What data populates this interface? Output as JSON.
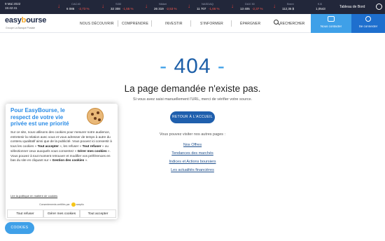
{
  "ticker": {
    "date": "9 Mai 2022",
    "time": "15:42:41",
    "items": [
      {
        "name": "CAC40",
        "value": "6 086",
        "change": "-2,73 %"
      },
      {
        "name": "SI30",
        "value": "32 308",
        "change": "-1,55 %"
      },
      {
        "name": "Nikkei",
        "value": "26 319",
        "change": "-2,53 %"
      },
      {
        "name": "NASDAQ",
        "value": "11 707",
        "change": "-1,66 %"
      },
      {
        "name": "DAX 30",
        "value": "13 405",
        "change": "-2,37 %"
      },
      {
        "name": "Brent",
        "value": "112,35 $",
        "change": ""
      },
      {
        "name": "€-$",
        "value": "1,0543",
        "change": ""
      }
    ],
    "dashboard_label": "Tableau de Bord"
  },
  "header": {
    "logo_main": "easy",
    "logo_y": "b",
    "logo_rest": "ourse",
    "logo_sub": "Groupe La Banque Postale",
    "nav": [
      "NOUS DÉCOUVRIR",
      "COMPRENDRE",
      "INVESTIR",
      "S'INFORMER",
      "ÉPARGNER"
    ],
    "search_label": "RECHERCHER",
    "contact_label": "Nous contacter",
    "login_label": "Se connecter"
  },
  "main": {
    "code_dash_left": "- ",
    "code": "404",
    "code_dash_right": " -",
    "title": "La page demandée n'existe pas.",
    "subtitle": "Si vous avez saisi manuellement l'URL, merci de vérifier votre source.",
    "back_button": "RETOUR À L'ACCUEIL",
    "other_pages": "Vous pouvez visiter nos autres pages :",
    "links": [
      "Nos Offres",
      "Tendances des marchés",
      "Indices et Actions boursiers",
      "Les actualités financières"
    ]
  },
  "cookie": {
    "title": "Pour EasyBourse, le respect de votre vie privée est une priorité",
    "body_p1": "Sur ce site, nous utilisons des cookies pour mesurer notre audience, entretenir la relation avec vous et vous adresser de temps à autre du contenu qualitatif ainsi que de la publicité. Vous pouvez ici consentir à tous les cookies « ",
    "b1": "Tout accepter",
    "body_p2": " », les refuser « ",
    "b2": "Tout refuser",
    "body_p3": " » ou sélectionner ceux auxquels vous consentez « ",
    "b3": "Gérer mes cookies",
    "body_p4": " ». Vous pouvez à tout moment retrouver et modifier vos préférences en bas du site en cliquant sur « ",
    "b4": "Gestion des cookies",
    "body_p5": " ».",
    "policy_link": "Lire la politique en matière de cookies",
    "certified_prefix": "Consentements certifiés par",
    "certified_brand": "axeptio",
    "btn_refuse": "Tout refuser",
    "btn_manage": "Gérer mes cookies",
    "btn_accept": "Tout accepter",
    "fab": "COOKIES"
  },
  "colors": {
    "ticker_bg": "#22273a",
    "negative": "#ff5b4f",
    "brand_blue": "#1d5fa8",
    "accent_blue": "#3fa0e8",
    "logo_orange": "#f5a623"
  }
}
